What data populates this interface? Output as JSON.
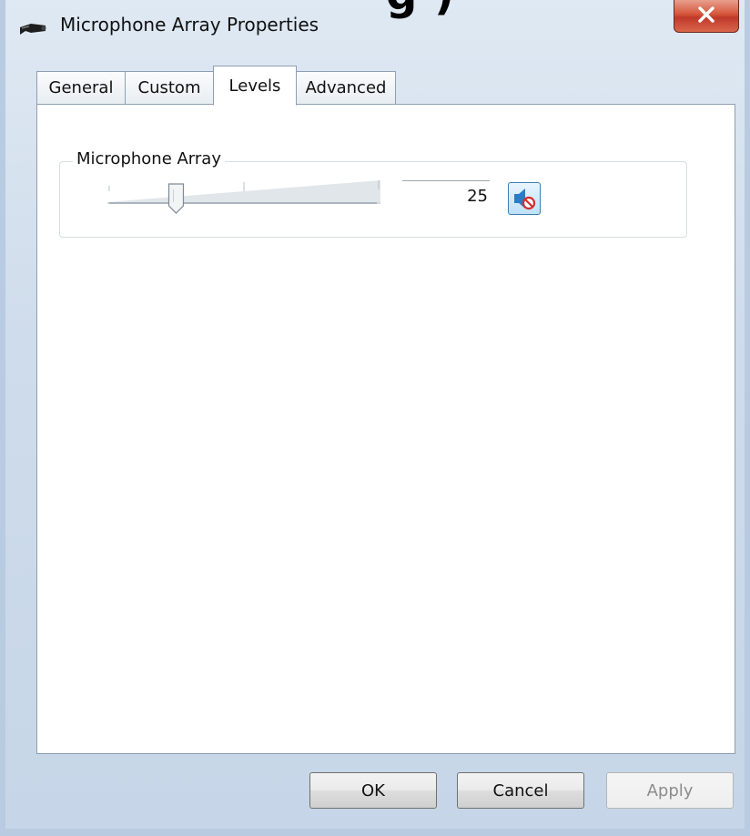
{
  "window": {
    "title": "Microphone Array Properties",
    "cutoff_text": "g )"
  },
  "tabs": [
    {
      "label": "General",
      "active": false
    },
    {
      "label": "Custom",
      "active": false
    },
    {
      "label": "Levels",
      "active": true
    },
    {
      "label": "Advanced",
      "active": false
    }
  ],
  "levels": {
    "group_label": "Microphone Array",
    "level_value": "25",
    "slider_fraction": 0.25,
    "mute_icon": "speaker-muted-icon"
  },
  "buttons": {
    "ok": "OK",
    "cancel": "Cancel",
    "apply": "Apply",
    "apply_enabled": false
  },
  "colors": {
    "close_button": "#c0392b",
    "tab_border": "#8e9fb2",
    "mute_accent": "#2a7dc4"
  }
}
